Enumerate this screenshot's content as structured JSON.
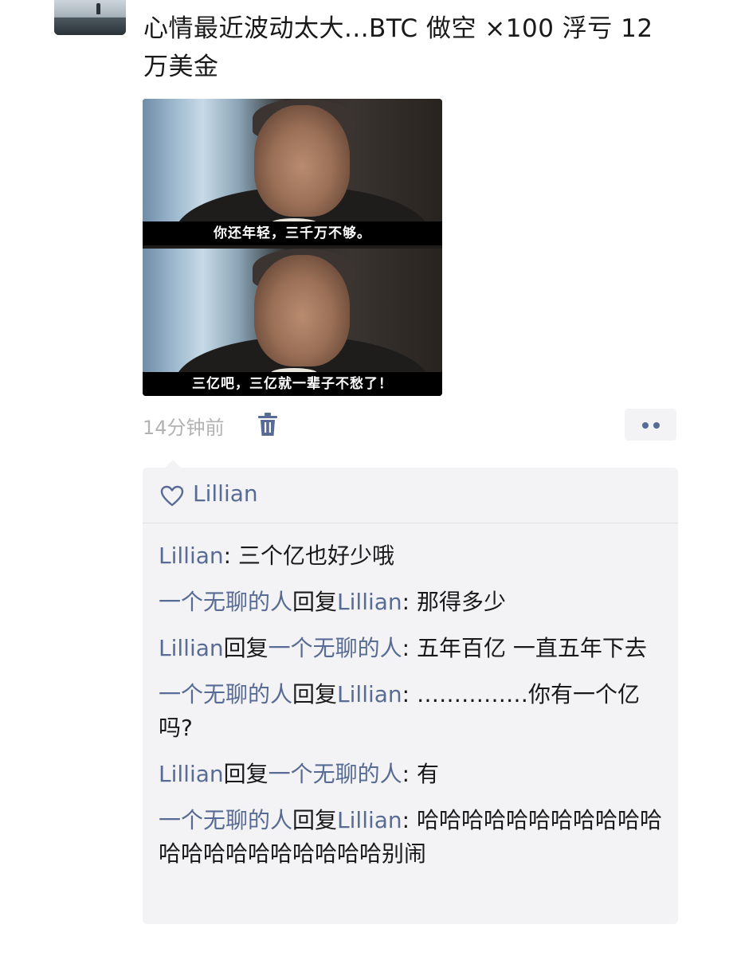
{
  "post": {
    "text": "心情最近波动太大...BTC 做空 ×100 浮亏 12 万美金",
    "image": {
      "captions": [
        "你还年轻，三千万不够。",
        "三亿吧，三亿就一辈子不愁了！"
      ]
    },
    "timestamp": "14分钟前",
    "delete_icon": "trash-icon",
    "more_icon": "more-dots-icon"
  },
  "likes": {
    "icon": "heart-icon",
    "names": "Lillian"
  },
  "comments": [
    {
      "author": "Lillian",
      "reply_word": "",
      "reply_to": "",
      "separator": ": ",
      "text": "三个亿也好少哦"
    },
    {
      "author": "一个无聊的人",
      "reply_word": "回复",
      "reply_to": "Lillian",
      "separator": ": ",
      "text": "那得多少"
    },
    {
      "author": "Lillian",
      "reply_word": "回复",
      "reply_to": "一个无聊的人",
      "separator": ": ",
      "text": "五年百亿 一直五年下去"
    },
    {
      "author": "一个无聊的人",
      "reply_word": "回复",
      "reply_to": "Lillian",
      "separator": ": ",
      "text": "……………你有一个亿吗?"
    },
    {
      "author": "Lillian",
      "reply_word": "回复",
      "reply_to": "一个无聊的人",
      "separator": ": ",
      "text": "有"
    },
    {
      "author": "一个无聊的人",
      "reply_word": "回复",
      "reply_to": "Lillian",
      "separator": ": ",
      "text": "哈哈哈哈哈哈哈哈哈哈哈哈哈哈哈哈哈哈哈哈哈别闹"
    }
  ],
  "colors": {
    "link": "#576b95",
    "text": "#191919",
    "muted": "#b2b2b2",
    "comment_bg": "#f3f3f5"
  }
}
